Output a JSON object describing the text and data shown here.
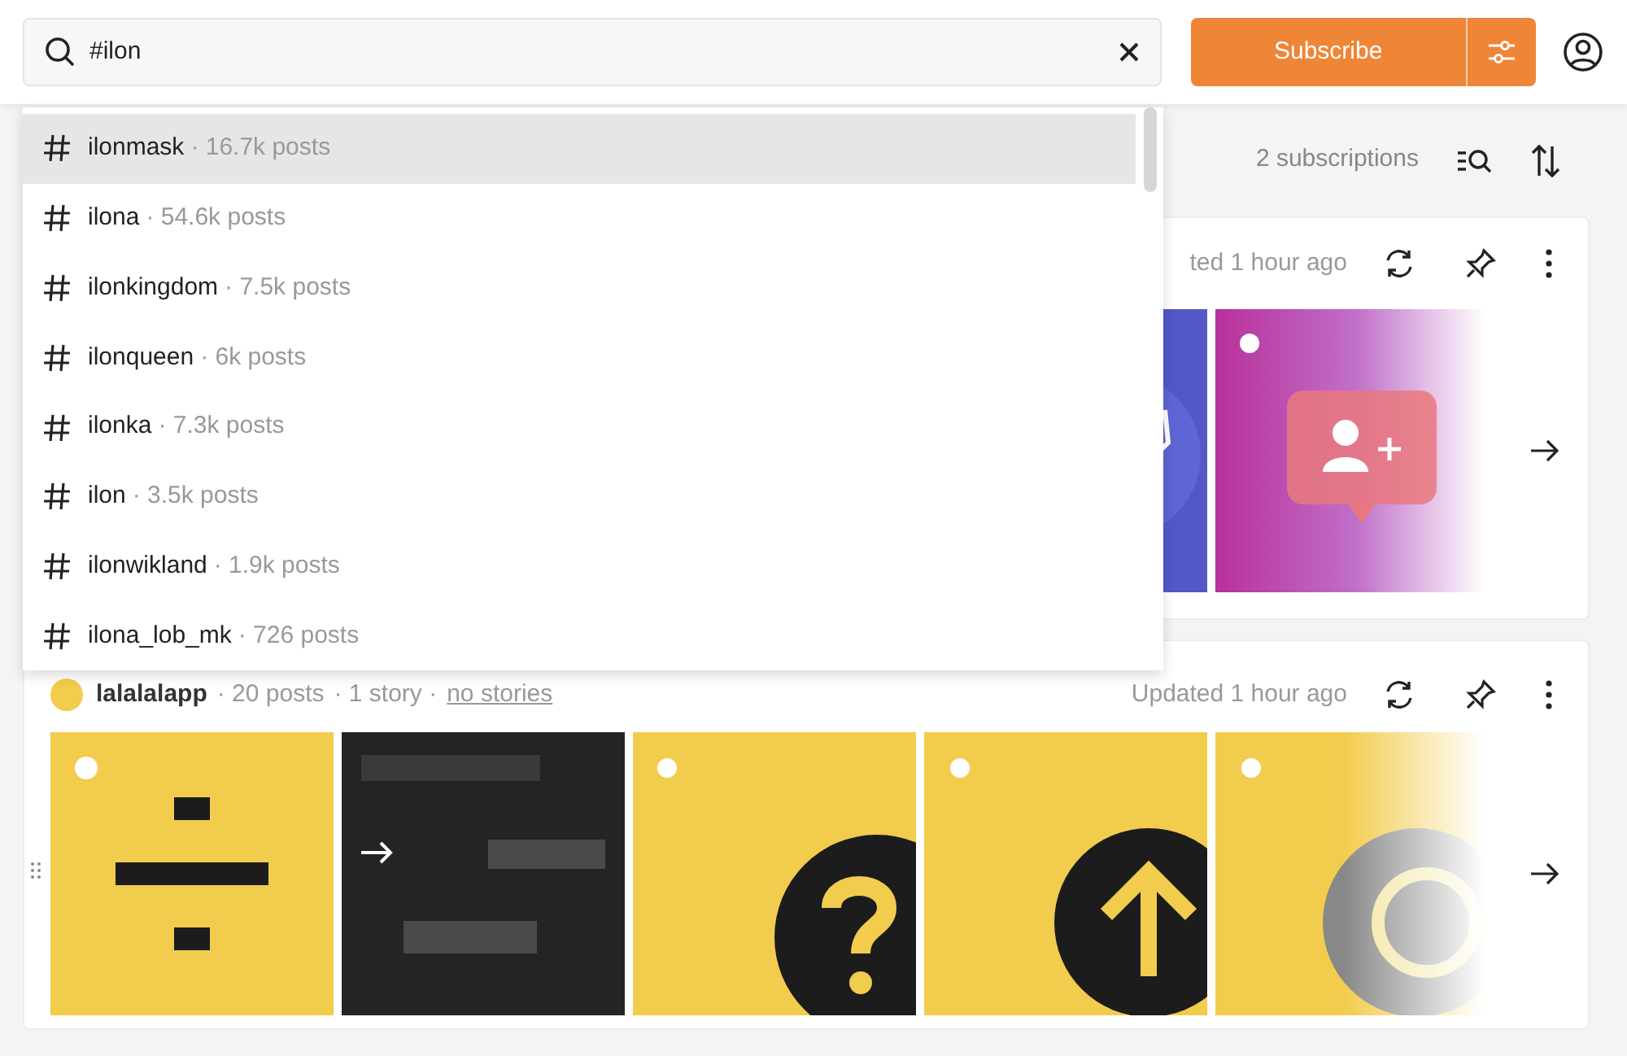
{
  "search": {
    "value": "#ilon"
  },
  "subscribe_button": "Subscribe",
  "suggestions": [
    {
      "tag": "ilonmask",
      "count": "· 16.7k posts",
      "selected": true
    },
    {
      "tag": "ilona",
      "count": "· 54.6k posts",
      "selected": false
    },
    {
      "tag": "ilonkingdom",
      "count": "· 7.5k posts",
      "selected": false
    },
    {
      "tag": "ilonqueen",
      "count": "· 6k posts",
      "selected": false
    },
    {
      "tag": "ilonka",
      "count": "· 7.3k posts",
      "selected": false
    },
    {
      "tag": "ilon",
      "count": "· 3.5k posts",
      "selected": false
    },
    {
      "tag": "ilonwikland",
      "count": "· 1.9k posts",
      "selected": false
    },
    {
      "tag": "ilona_lob_mk",
      "count": "· 726 posts",
      "selected": false
    }
  ],
  "toolbar": {
    "subscriptions": "2 subscriptions"
  },
  "cards": [
    {
      "updated": "ted 1 hour ago"
    },
    {
      "account": {
        "name": "lalalalapp",
        "posts": "· 20 posts",
        "stories": "· 1 story ·",
        "link": "no stories"
      },
      "updated": "Updated 1 hour ago"
    }
  ]
}
